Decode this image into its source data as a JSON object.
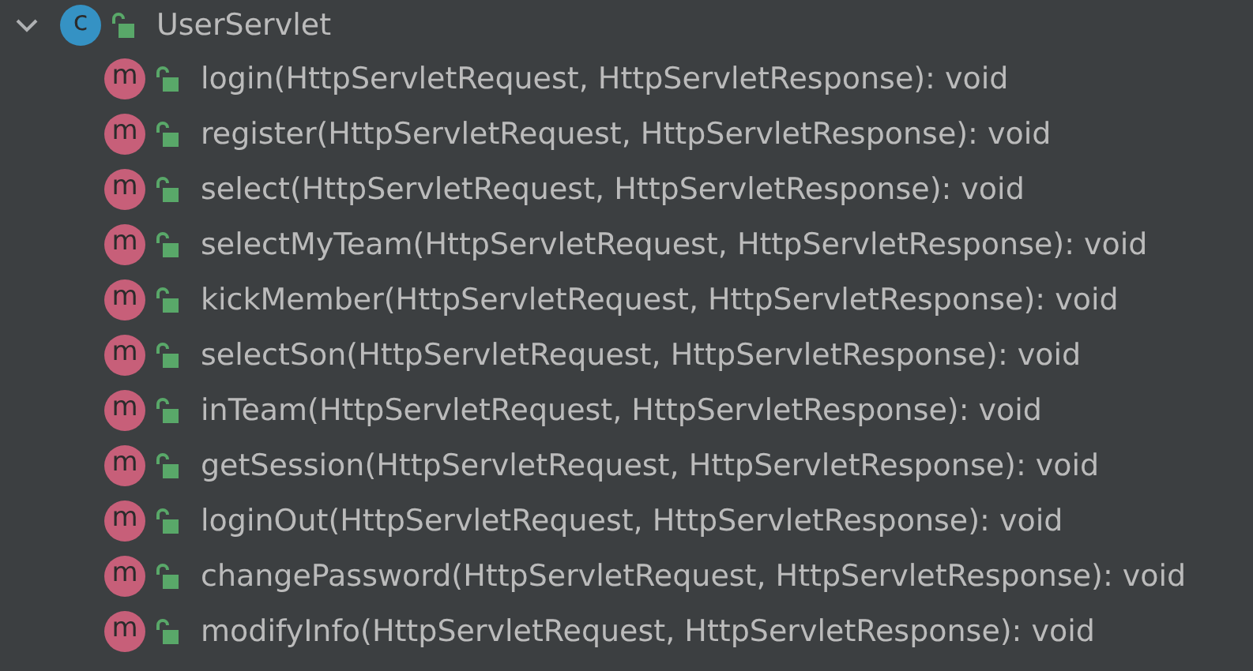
{
  "tree": {
    "label": "UserServlet",
    "badge": "c",
    "kind": "class",
    "expanded": true,
    "children": [
      {
        "label": "login(HttpServletRequest, HttpServletResponse): void",
        "badge": "m",
        "kind": "method"
      },
      {
        "label": "register(HttpServletRequest, HttpServletResponse): void",
        "badge": "m",
        "kind": "method"
      },
      {
        "label": "select(HttpServletRequest, HttpServletResponse): void",
        "badge": "m",
        "kind": "method"
      },
      {
        "label": "selectMyTeam(HttpServletRequest, HttpServletResponse): void",
        "badge": "m",
        "kind": "method"
      },
      {
        "label": "kickMember(HttpServletRequest, HttpServletResponse): void",
        "badge": "m",
        "kind": "method"
      },
      {
        "label": "selectSon(HttpServletRequest, HttpServletResponse): void",
        "badge": "m",
        "kind": "method"
      },
      {
        "label": "inTeam(HttpServletRequest, HttpServletResponse): void",
        "badge": "m",
        "kind": "method"
      },
      {
        "label": "getSession(HttpServletRequest, HttpServletResponse): void",
        "badge": "m",
        "kind": "method"
      },
      {
        "label": "loginOut(HttpServletRequest, HttpServletResponse): void",
        "badge": "m",
        "kind": "method"
      },
      {
        "label": "changePassword(HttpServletRequest, HttpServletResponse): void",
        "badge": "m",
        "kind": "method"
      },
      {
        "label": "modifyInfo(HttpServletRequest, HttpServletResponse): void",
        "badge": "m",
        "kind": "method"
      }
    ]
  }
}
